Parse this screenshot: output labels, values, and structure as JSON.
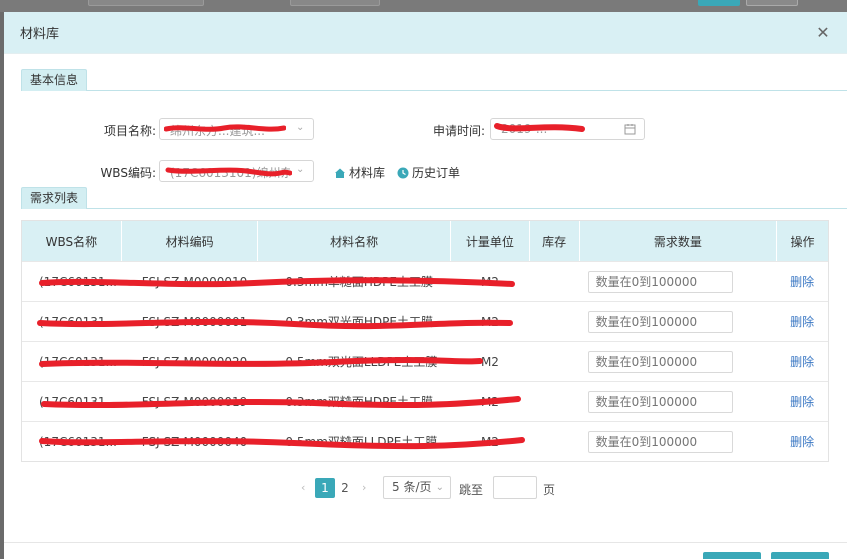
{
  "dialog": {
    "title": "材料库"
  },
  "sections": {
    "basic": "基本信息",
    "demand": "需求列表"
  },
  "form": {
    "project_label": "项目名称:",
    "project_value": "绵州东方...建筑...",
    "apply_time_label": "申请时间:",
    "apply_time_value": "2019-...",
    "wbs_label": "WBS编码:",
    "wbs_value": "(17C6013101)绵州东...",
    "link_material": "材料库",
    "link_history": "历史订单"
  },
  "table": {
    "headers": [
      "WBS名称",
      "材料编码",
      "材料名称",
      "计量单位",
      "库存",
      "需求数量",
      "操作"
    ],
    "qty_placeholder": "数量在0到100000",
    "delete_label": "删除",
    "rows": [
      {
        "wbs": "(17C60131...",
        "code": "FSJ-SZ-M0000010",
        "name": "0.3mm单糙面HDPE土工膜",
        "unit": "M2"
      },
      {
        "wbs": "(17C60131...",
        "code": "FSJ-SZ-M0000001",
        "name": "0.3mm双光面HDPE土工膜",
        "unit": "M2"
      },
      {
        "wbs": "(17C60131...",
        "code": "FSJ-SZ-M0000020",
        "name": "0.5mm双光面LLDPE土工膜",
        "unit": "M2"
      },
      {
        "wbs": "(17C60131...",
        "code": "FSJ-SZ-M0000019",
        "name": "0.3mm双糙面HDPE土工膜",
        "unit": "M2"
      },
      {
        "wbs": "(17C60131...",
        "code": "FSJ-SZ-M0000040",
        "name": "0.5mm双糙面LLDPE土工膜",
        "unit": "M2"
      }
    ]
  },
  "pagination": {
    "prev": "‹",
    "next": "›",
    "pages": [
      "1",
      "2"
    ],
    "page_size": "5 条/页",
    "jump_label": "跳至",
    "page_unit": "页"
  },
  "colors": {
    "accent": "#3aa8b8",
    "header_bg": "#d9f0f4",
    "link": "#3b78c4",
    "redaction": "#e8202a"
  }
}
